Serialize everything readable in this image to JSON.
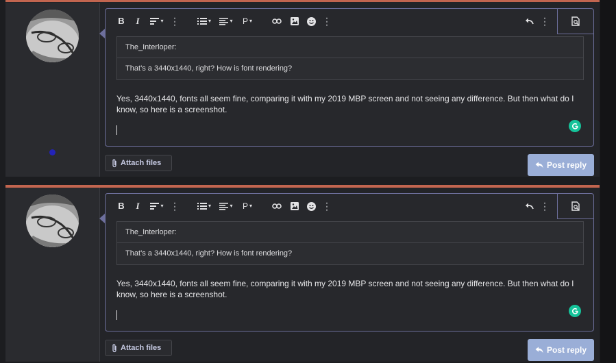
{
  "posts": [
    {
      "quote": {
        "author": "The_Interloper:",
        "text": "That’s a 3440x1440, right? How is font rendering?"
      },
      "body": "Yes, 3440x1440, fonts all seem fine, comparing it with my 2019 MBP screen and not seeing any difference.  But then what do I know, so here is a screenshot.",
      "attach_label": "Attach files",
      "reply_label": "Post reply"
    },
    {
      "quote": {
        "author": "The_Interloper:",
        "text": "That’s a 3440x1440, right? How is font rendering?"
      },
      "body": "Yes, 3440x1440, fonts all seem fine, comparing it with my 2019 MBP screen and not seeing any difference.  But then what do I know, so here is a screenshot.",
      "attach_label": "Attach files",
      "reply_label": "Post reply"
    }
  ],
  "toolbar": {
    "bold": "B",
    "italic": "I",
    "paragraph": "P",
    "more": "⋮",
    "caret": "▾"
  },
  "colors": {
    "accent_bar": "#c2654f",
    "editor_border": "#6d6f9c",
    "post_reply_bg": "#9aaed7",
    "grammarly": "#15c39a",
    "online_dot": "#2323b8"
  }
}
